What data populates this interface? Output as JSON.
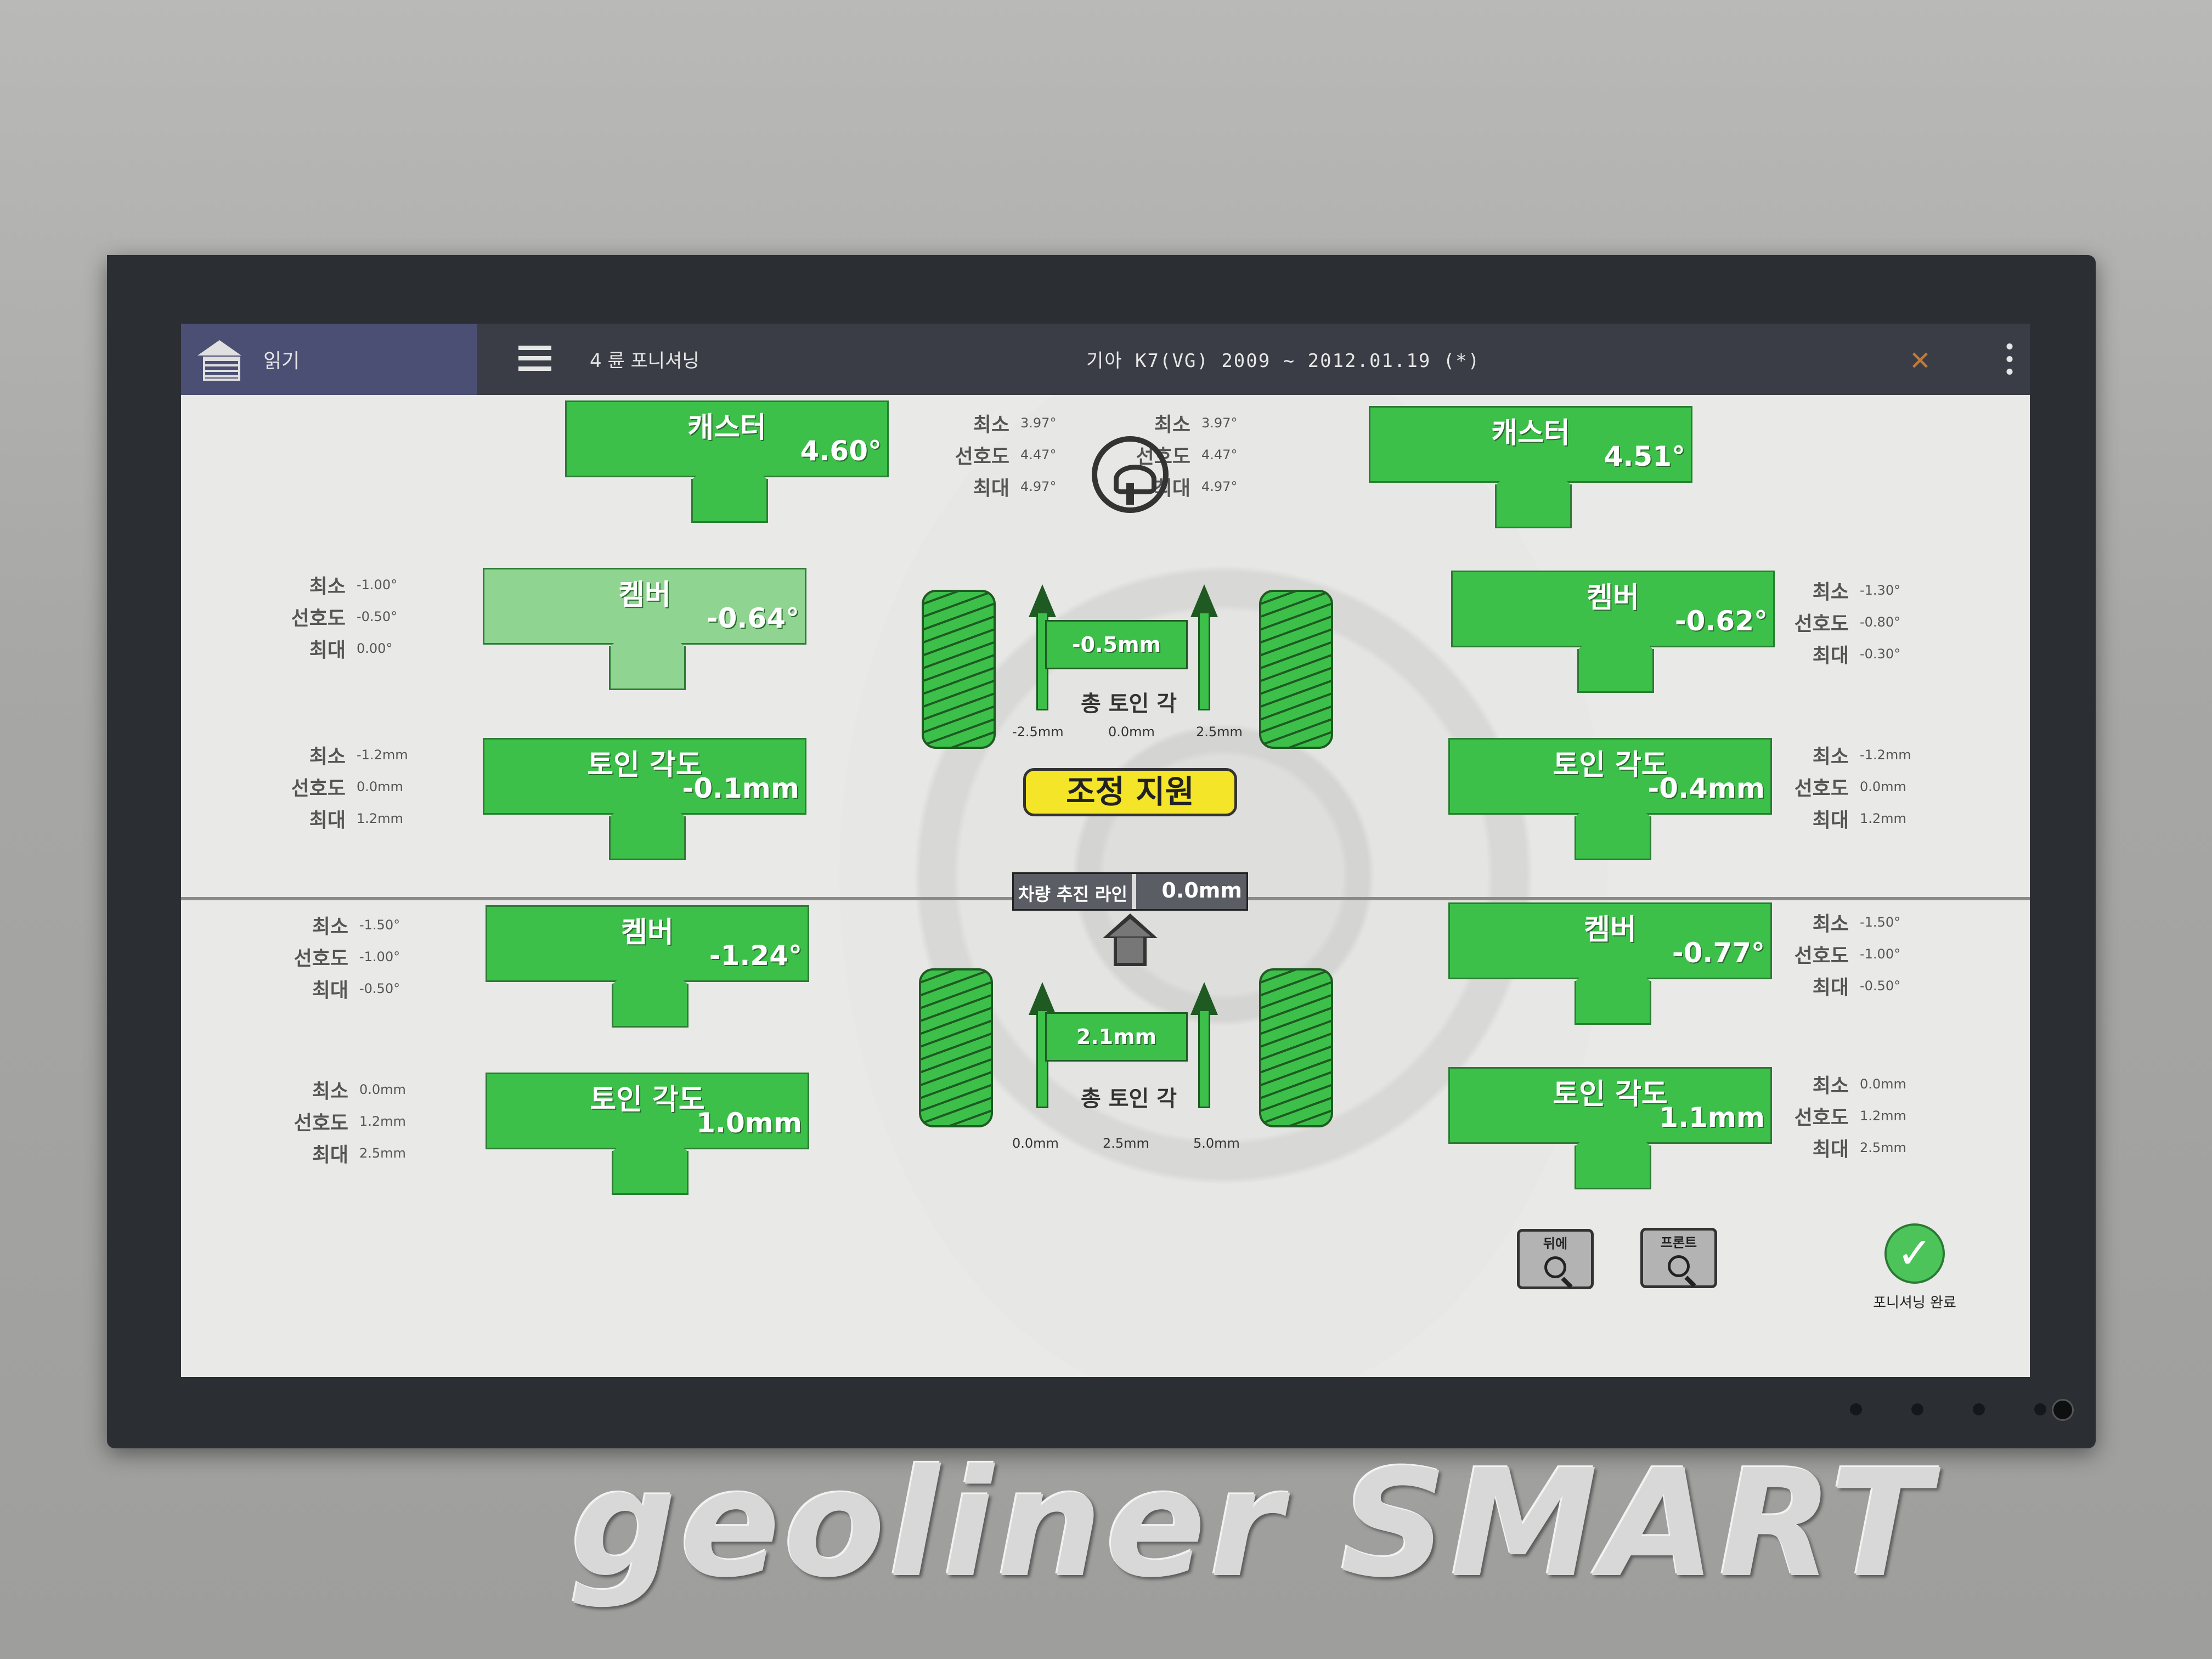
{
  "header": {
    "read_label": "읽기",
    "mode": "4 륜 포니셔닝",
    "vehicle": "기아 K7(VG) 2009 ~ 2012.01.19 (*)"
  },
  "spec_labels": {
    "min": "최소",
    "pref": "선호도",
    "max": "최대"
  },
  "front": {
    "caster_spec": {
      "min": "3.97°",
      "pref": "4.47°",
      "max": "4.97°"
    },
    "left": {
      "caster": {
        "name": "캐스터",
        "value": "4.60°"
      },
      "camber": {
        "name": "켐버",
        "value": "-0.64°",
        "spec": {
          "min": "-1.00°",
          "pref": "-0.50°",
          "max": "0.00°"
        }
      },
      "toe": {
        "name": "토인 각도",
        "value": "-0.1mm",
        "spec": {
          "min": "-1.2mm",
          "pref": "0.0mm",
          "max": "1.2mm"
        }
      }
    },
    "right": {
      "caster": {
        "name": "캐스터",
        "value": "4.51°"
      },
      "camber": {
        "name": "켐버",
        "value": "-0.62°",
        "spec": {
          "min": "-1.30°",
          "pref": "-0.80°",
          "max": "-0.30°"
        }
      },
      "toe": {
        "name": "토인 각도",
        "value": "-0.4mm",
        "spec": {
          "min": "-1.2mm",
          "pref": "0.0mm",
          "max": "1.2mm"
        }
      }
    },
    "total_toe": {
      "value": "-0.5mm",
      "label": "총 토인 각",
      "ticks": [
        "-2.5mm",
        "0.0mm",
        "2.5mm"
      ]
    }
  },
  "rear": {
    "left": {
      "camber": {
        "name": "켐버",
        "value": "-1.24°",
        "spec": {
          "min": "-1.50°",
          "pref": "-1.00°",
          "max": "-0.50°"
        }
      },
      "toe": {
        "name": "토인 각도",
        "value": "1.0mm",
        "spec": {
          "min": "0.0mm",
          "pref": "1.2mm",
          "max": "2.5mm"
        }
      }
    },
    "right": {
      "camber": {
        "name": "켐버",
        "value": "-0.77°",
        "spec": {
          "min": "-1.50°",
          "pref": "-1.00°",
          "max": "-0.50°"
        }
      },
      "toe": {
        "name": "토인 각도",
        "value": "1.1mm",
        "spec": {
          "min": "0.0mm",
          "pref": "1.2mm",
          "max": "2.5mm"
        }
      }
    },
    "total_toe": {
      "value": "2.1mm",
      "label": "총 토인 각",
      "ticks": [
        "0.0mm",
        "2.5mm",
        "5.0mm"
      ]
    }
  },
  "adjust_button": "조정 지원",
  "thrust": {
    "label": "차량 추진 라인",
    "value": "0.0mm"
  },
  "zoom_rear": "뒤에",
  "zoom_front": "프론트",
  "done_label": "포니셔닝 완료",
  "brand": "geoliner SMART",
  "colors": {
    "ok_green": "#3cc04a",
    "pale_green": "#8fd491",
    "adjust_yellow": "#f5e528"
  }
}
